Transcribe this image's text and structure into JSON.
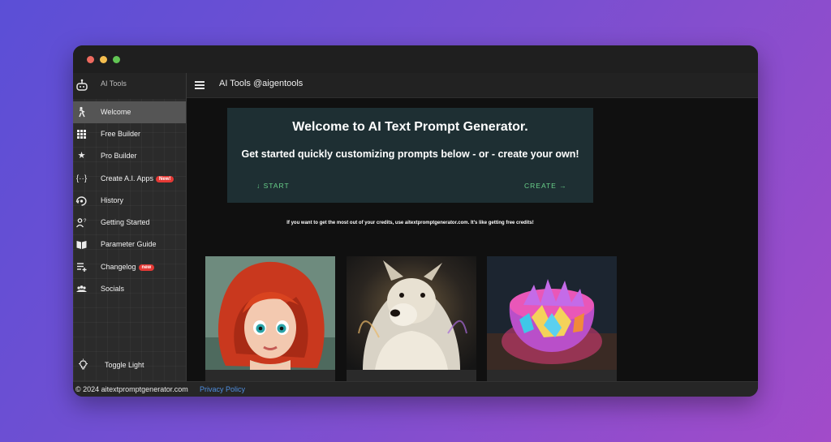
{
  "sidebar": {
    "brand": "AI Tools",
    "items": [
      {
        "label": "Welcome",
        "icon": "person-icon"
      },
      {
        "label": "Free Builder",
        "icon": "grid-icon"
      },
      {
        "label": "Pro Builder",
        "icon": "sparkle-icon"
      },
      {
        "label": "Create A.I. Apps",
        "icon": "braces-icon",
        "badge": "New!"
      },
      {
        "label": "History",
        "icon": "history-icon"
      },
      {
        "label": "Getting Started",
        "icon": "help-person-icon"
      },
      {
        "label": "Parameter Guide",
        "icon": "book-icon"
      },
      {
        "label": "Changelog",
        "icon": "list-add-icon",
        "badge": "new"
      },
      {
        "label": "Socials",
        "icon": "people-icon"
      }
    ],
    "toggle_label": "Toggle Light"
  },
  "header": {
    "title": "AI Tools @aigentools"
  },
  "hero": {
    "title": "Welcome to AI Text Prompt Generator.",
    "subtitle": "Get started quickly customizing prompts below - or - create your own!",
    "start_label": "↓ START",
    "create_label": "CREATE →"
  },
  "note": "If you want to get the most out of your credits, use aitextpromptgenerator.com. It's like getting free credits!",
  "footer": {
    "copyright": "© 2024 aitextpromptgenerator.com",
    "privacy": "Privacy Policy"
  },
  "colors": {
    "accent_green": "#69d08a",
    "hero_bg": "#1e2f33",
    "badge_red": "#e53935",
    "link_blue": "#4f8fe0"
  }
}
